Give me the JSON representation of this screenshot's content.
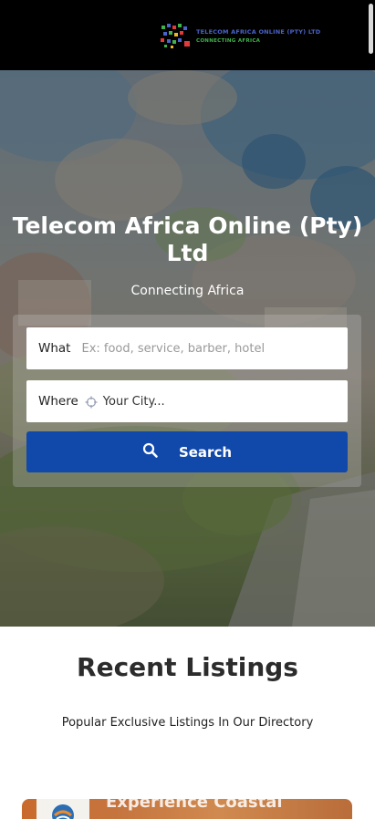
{
  "header": {
    "logo_line1": "TELECOM AFRICA ONLINE (PTY) LTD",
    "logo_line2": "CONNECTING AFRICA"
  },
  "hero": {
    "title": "Telecom Africa Online (Pty) Ltd",
    "subtitle": "Connecting Africa"
  },
  "search": {
    "what_label": "What",
    "what_placeholder": "Ex: food, service, barber, hotel",
    "where_label": "Where",
    "where_placeholder": "Your City...",
    "button_label": "Search",
    "button_icon": "search-icon",
    "where_icon": "crosshair-icon",
    "button_color": "#1149aa"
  },
  "recent": {
    "title": "Recent Listings",
    "subtitle": "Popular Exclusive Listings In Our Directory",
    "card_text": "Experience Coastal"
  }
}
